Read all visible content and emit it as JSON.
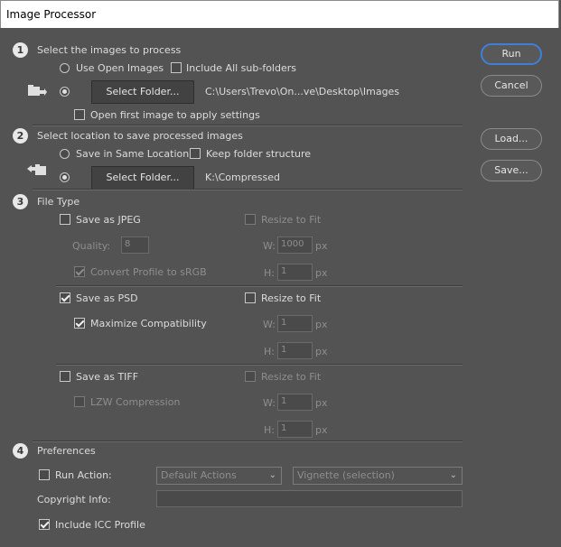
{
  "window": {
    "title": "Image Processor"
  },
  "step1": {
    "num": "1",
    "heading": "Select the images to process",
    "use_open": "Use Open Images",
    "include_sub": "Include All sub-folders",
    "select_folder": "Select Folder...",
    "folder_path": "C:\\Users\\Trevo\\On...ve\\Desktop\\Images",
    "open_first": "Open first image to apply settings"
  },
  "step2": {
    "num": "2",
    "heading": "Select location to save processed images",
    "save_same": "Save in Same Location",
    "keep_structure": "Keep folder structure",
    "select_folder": "Select Folder...",
    "folder_path": "K:\\Compressed"
  },
  "step3": {
    "num": "3",
    "heading": "File Type",
    "jpeg": {
      "label": "Save as JPEG",
      "resize": "Resize to Fit",
      "quality_label": "Quality:",
      "quality": "8",
      "w_label": "W:",
      "w": "1000",
      "w_unit": "px",
      "h_label": "H:",
      "h": "1",
      "h_unit": "px",
      "convert": "Convert Profile to sRGB"
    },
    "psd": {
      "label": "Save as PSD",
      "resize": "Resize to Fit",
      "maximize": "Maximize Compatibility",
      "w_label": "W:",
      "w": "1",
      "w_unit": "px",
      "h_label": "H:",
      "h": "1",
      "h_unit": "px"
    },
    "tiff": {
      "label": "Save as TIFF",
      "resize": "Resize to Fit",
      "lzw": "LZW Compression",
      "w_label": "W:",
      "w": "1",
      "w_unit": "px",
      "h_label": "H:",
      "h": "1",
      "h_unit": "px"
    }
  },
  "step4": {
    "num": "4",
    "heading": "Preferences",
    "run_action": "Run Action:",
    "action_set": "Default Actions",
    "action": "Vignette (selection)",
    "copyright": "Copyright Info:",
    "include_icc": "Include ICC Profile"
  },
  "buttons": {
    "run": "Run",
    "cancel": "Cancel",
    "load": "Load...",
    "save": "Save..."
  }
}
